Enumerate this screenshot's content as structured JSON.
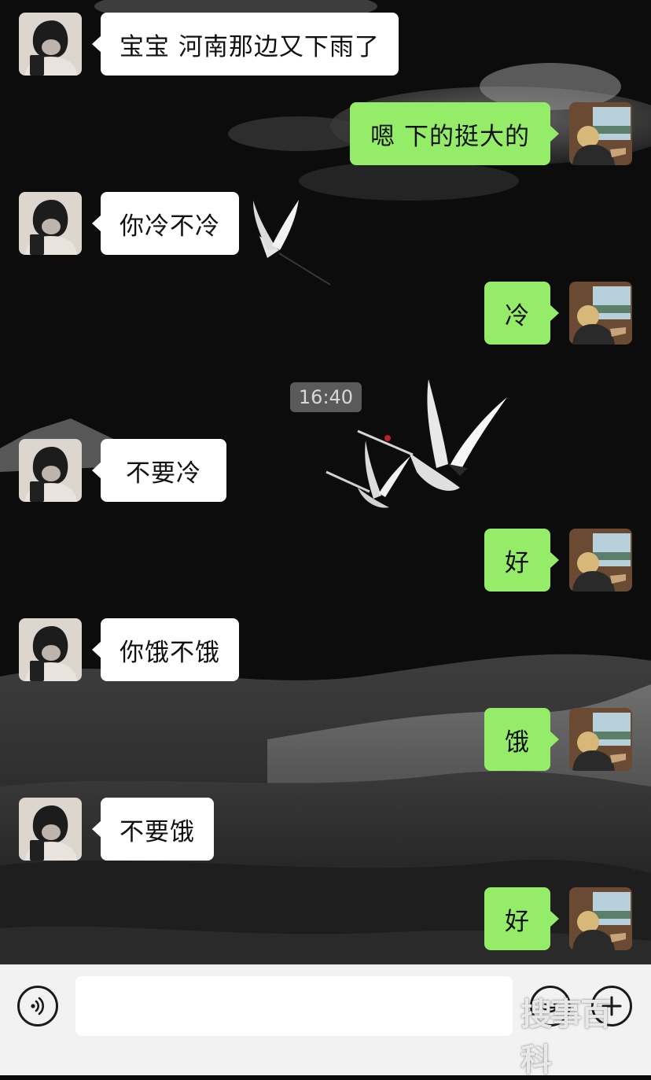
{
  "time_label": "16:40",
  "messages": [
    {
      "side": "left",
      "text": "宝宝 河南那边又下雨了"
    },
    {
      "side": "right",
      "text": "嗯 下的挺大的"
    },
    {
      "side": "left",
      "text": "你冷不冷"
    },
    {
      "side": "right",
      "text": "冷"
    },
    {
      "side": "left",
      "text": "不要冷"
    },
    {
      "side": "right",
      "text": "好"
    },
    {
      "side": "left",
      "text": "你饿不饿"
    },
    {
      "side": "right",
      "text": "饿"
    },
    {
      "side": "left",
      "text": "不要饿"
    },
    {
      "side": "right",
      "text": "好"
    }
  ],
  "input_bar": {
    "input_value": "",
    "voice_icon": "voice-icon",
    "emoji_icon": "emoji-icon",
    "plus_icon": "plus-icon"
  },
  "watermark_text": "搜事百科",
  "colors": {
    "background": "#0b0b0b",
    "incoming_bubble": "#ffffff",
    "outgoing_bubble": "#95ec69",
    "timestamp_bg": "#5a5a5a",
    "input_bar_bg": "#f2f2f2"
  }
}
